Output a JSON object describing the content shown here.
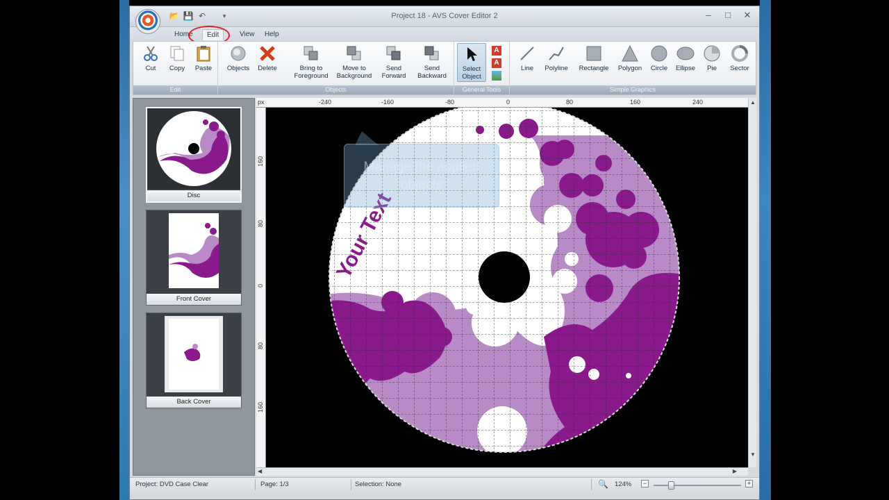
{
  "window": {
    "title": "Project 18 - AVS Cover Editor 2",
    "minimize": "–",
    "maximize": "□",
    "close": "✕"
  },
  "tabs": [
    "Home",
    "Edit",
    "View",
    "Help"
  ],
  "active_tab": "Edit",
  "ribbon": {
    "edit_group": {
      "label": "Edit",
      "buttons": [
        "Cut",
        "Copy",
        "Paste"
      ]
    },
    "objects_group": {
      "label": "Objects",
      "buttons": [
        "Objects",
        "Delete",
        "Bring to Foreground",
        "Move to Background",
        "Send Forward",
        "Send Backward"
      ]
    },
    "general_tools": {
      "label": "General Tools",
      "select": "Select Object"
    },
    "simple_graphics": {
      "label": "Simple Graphics",
      "buttons": [
        "Line",
        "Polyline",
        "Rectangle",
        "Polygon",
        "Circle",
        "Ellipse",
        "Pie",
        "Sector"
      ]
    }
  },
  "sidebar": {
    "items": [
      {
        "label": "Disc",
        "selected": true
      },
      {
        "label": "Front Cover",
        "selected": false
      },
      {
        "label": "Back Cover",
        "selected": false
      }
    ]
  },
  "ruler": {
    "unit": "px",
    "top_ticks": [
      "-240",
      "-160",
      "-80",
      "0",
      "80",
      "160",
      "240"
    ],
    "left_ticks": [
      "160",
      "80",
      "0",
      "80",
      "160"
    ]
  },
  "canvas": {
    "disc_text": "Your Text",
    "tooltip": "Manage the applied objects",
    "colors": {
      "dark_purple": "#8a1a8c",
      "light_purple": "#b98bc6",
      "disc_white": "#ffffff",
      "background": "#000000"
    }
  },
  "status": {
    "project": "Project: DVD Case Clear",
    "page": "Page: 1/3",
    "selection": "Selection: None",
    "zoom": "124%"
  }
}
